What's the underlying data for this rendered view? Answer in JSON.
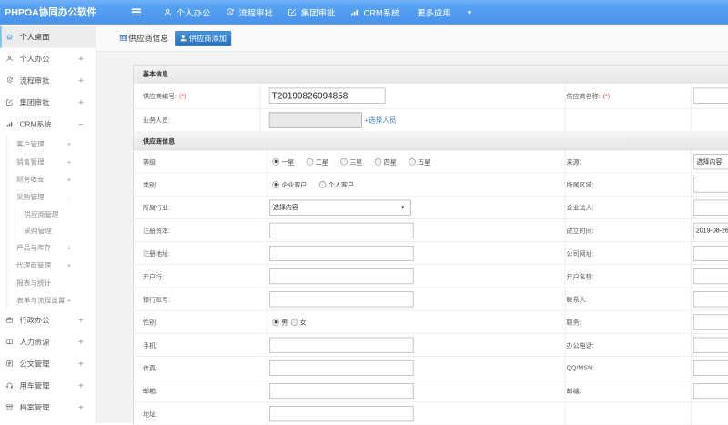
{
  "colors": {
    "topbar_blue": "#3c8fec",
    "active_tab_blue": "#3381cd",
    "link_blue": "#3d7fc4",
    "required_red": "#ee5555",
    "sidebar_active_accent": "#7fc0ea"
  },
  "topbar": {
    "logo": "PHPOA协同办公软件",
    "nav": [
      {
        "label": "个人办公",
        "icon": "person-icon"
      },
      {
        "label": "流程审批",
        "icon": "process-icon"
      },
      {
        "label": "集团审批",
        "icon": "approval-icon"
      },
      {
        "label": "CRM系统",
        "icon": "chart-icon"
      },
      {
        "label": "更多应用",
        "icon": "caret-down-icon"
      }
    ]
  },
  "tabs": [
    {
      "label": "供应商信息",
      "active": false,
      "icon": "table-icon"
    },
    {
      "label": "供应商添加",
      "active": true,
      "icon": "person-add-icon"
    }
  ],
  "sidebar": {
    "items": [
      {
        "label": "个人桌面",
        "icon": "home-icon",
        "active": true
      },
      {
        "label": "个人办公",
        "icon": "person-icon",
        "toggle": "+"
      },
      {
        "label": "流程审批",
        "icon": "process-icon",
        "toggle": "+"
      },
      {
        "label": "集团审批",
        "icon": "approval-icon",
        "toggle": "+"
      },
      {
        "label": "CRM系统",
        "icon": "chart-icon",
        "toggle": "−",
        "children": [
          {
            "label": "客户管理",
            "toggle": "+"
          },
          {
            "label": "销售管理",
            "toggle": "+"
          },
          {
            "label": "财务收支",
            "toggle": "+"
          },
          {
            "label": "采购管理",
            "toggle": "−",
            "children": [
              {
                "label": "供应商管理"
              },
              {
                "label": "采购管理"
              }
            ]
          },
          {
            "label": "产品与库存",
            "toggle": "+"
          },
          {
            "label": "代理商管理",
            "toggle": "+"
          },
          {
            "label": "报表与统计"
          },
          {
            "label": "表单与流程设置",
            "toggle": "+"
          }
        ]
      },
      {
        "label": "行政办公",
        "icon": "briefcase-icon",
        "toggle": "+"
      },
      {
        "label": "人力资源",
        "icon": "book-icon",
        "toggle": "+"
      },
      {
        "label": "公文管理",
        "icon": "document-icon",
        "toggle": "+"
      },
      {
        "label": "用车管理",
        "icon": "headset-icon",
        "toggle": "+"
      },
      {
        "label": "档案管理",
        "icon": "archive-icon",
        "toggle": "+"
      }
    ]
  },
  "form": {
    "required_mark": "(*)",
    "sections": [
      {
        "title": "基本信息",
        "fields": {
          "supplier_no": {
            "label": "供应商编号:",
            "required": true,
            "value": "T20190826094858"
          },
          "supplier_name": {
            "label": "供应商名称:",
            "required": true,
            "value": ""
          },
          "staff": {
            "label": "业务人员:",
            "value": "",
            "link": "+选择人员"
          }
        }
      },
      {
        "title": "供应商信息",
        "fields": {
          "grade": {
            "label": "等级:",
            "options": [
              "一星",
              "二星",
              "三星",
              "四星",
              "五星"
            ],
            "selected": "一星"
          },
          "source": {
            "label": "来源:",
            "value": "选择内容"
          },
          "category": {
            "label": "类别:",
            "options": [
              "企业客户",
              "个人客户"
            ],
            "selected": "企业客户"
          },
          "region": {
            "label": "所属区域:",
            "value": ""
          },
          "industry": {
            "label": "所属行业:",
            "value": "选择内容"
          },
          "legal_person": {
            "label": "企业法人:",
            "value": ""
          },
          "registered_capital": {
            "label": "注册资本:",
            "value": ""
          },
          "founded_date": {
            "label": "成立时间:",
            "value": "2019-08-26"
          },
          "registered_address": {
            "label": "注册地址:",
            "value": ""
          },
          "website": {
            "label": "公司网址:",
            "value": ""
          },
          "bank": {
            "label": "开户行:",
            "value": ""
          },
          "account_name": {
            "label": "开户名称:",
            "value": ""
          },
          "bank_account": {
            "label": "银行账号:",
            "value": ""
          },
          "contact": {
            "label": "联系人:",
            "value": ""
          },
          "gender": {
            "label": "性别:",
            "options": [
              "男",
              "女"
            ],
            "selected": "男"
          },
          "position": {
            "label": "职务:",
            "value": ""
          },
          "mobile": {
            "label": "手机:",
            "value": ""
          },
          "office_phone": {
            "label": "办公电话:",
            "value": ""
          },
          "fax": {
            "label": "传真:",
            "value": ""
          },
          "qq_msn": {
            "label": "QQ/MSN:",
            "value": ""
          },
          "email": {
            "label": "邮箱:",
            "value": ""
          },
          "zip": {
            "label": "邮编:",
            "value": ""
          },
          "address": {
            "label": "地址:",
            "value": ""
          }
        }
      }
    ]
  }
}
